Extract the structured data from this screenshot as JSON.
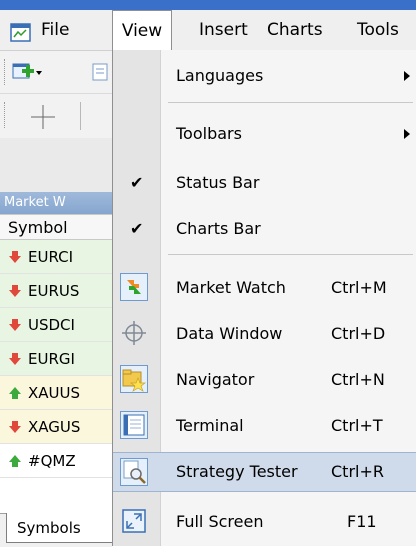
{
  "menubar": {
    "file": "File",
    "view": "View",
    "insert": "Insert",
    "charts": "Charts",
    "tools": "Tools"
  },
  "market_watch": {
    "title": "Market W",
    "column_header": "Symbol",
    "rows": [
      {
        "symbol": "EURCI",
        "direction": "down"
      },
      {
        "symbol": "EURUS",
        "direction": "down"
      },
      {
        "symbol": "USDCI",
        "direction": "down"
      },
      {
        "symbol": "EURGI",
        "direction": "down"
      },
      {
        "symbol": "XAUUS",
        "direction": "up"
      },
      {
        "symbol": "XAGUS",
        "direction": "down"
      },
      {
        "symbol": "#QMZ",
        "direction": "up"
      }
    ],
    "tab_label": "Symbols"
  },
  "view_menu": {
    "items": [
      {
        "label": "Languages",
        "shortcut": "",
        "submenu": true,
        "icon": "",
        "checked": false
      },
      {
        "label": "Toolbars",
        "shortcut": "",
        "submenu": true,
        "icon": "",
        "checked": false
      },
      {
        "label": "Status Bar",
        "shortcut": "",
        "submenu": false,
        "icon": "check-icon",
        "checked": true
      },
      {
        "label": "Charts Bar",
        "shortcut": "",
        "submenu": false,
        "icon": "check-icon",
        "checked": true
      },
      {
        "label": "Market Watch",
        "shortcut": "Ctrl+M",
        "submenu": false,
        "icon": "market-watch-icon",
        "checked": false
      },
      {
        "label": "Data Window",
        "shortcut": "Ctrl+D",
        "submenu": false,
        "icon": "crosshair-icon",
        "checked": false
      },
      {
        "label": "Navigator",
        "shortcut": "Ctrl+N",
        "submenu": false,
        "icon": "navigator-icon",
        "checked": false
      },
      {
        "label": "Terminal",
        "shortcut": "Ctrl+T",
        "submenu": false,
        "icon": "terminal-icon",
        "checked": false
      },
      {
        "label": "Strategy Tester",
        "shortcut": "Ctrl+R",
        "submenu": false,
        "icon": "strategy-tester-icon",
        "checked": false,
        "highlighted": true
      },
      {
        "label": "Full Screen",
        "shortcut": "F11",
        "submenu": false,
        "icon": "full-screen-icon",
        "checked": false
      }
    ]
  },
  "colors": {
    "highlight": "#cfdbea",
    "arrow_down": "#e0483b",
    "arrow_up": "#3caa3c",
    "title_bar": "#3a70c7"
  }
}
